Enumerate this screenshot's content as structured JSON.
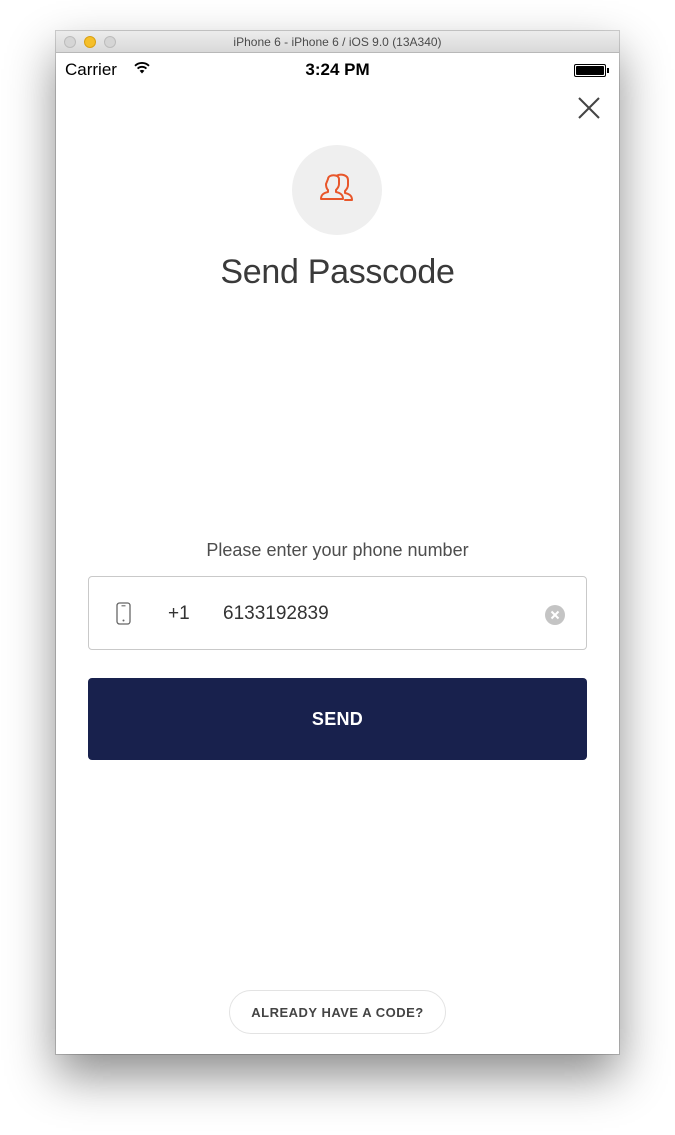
{
  "window": {
    "title": "iPhone 6 - iPhone 6 / iOS 9.0 (13A340)"
  },
  "status_bar": {
    "carrier": "Carrier",
    "time": "3:24 PM",
    "wifi_icon": "wifi-icon",
    "battery_icon": "battery-icon"
  },
  "header": {
    "close_icon": "close-icon",
    "avatar_icon": "users-icon",
    "title": "Send Passcode"
  },
  "form": {
    "prompt": "Please enter your phone number",
    "device_icon": "phone-icon",
    "country_code": "+1",
    "phone_value": "6133192839",
    "clear_icon": "clear-circle-icon",
    "send_label": "SEND"
  },
  "footer": {
    "already_have_code_label": "ALREADY HAVE A CODE?"
  },
  "colors": {
    "accent": "#e8562a",
    "button_bg": "#18214d",
    "avatar_bg": "#efefef"
  }
}
